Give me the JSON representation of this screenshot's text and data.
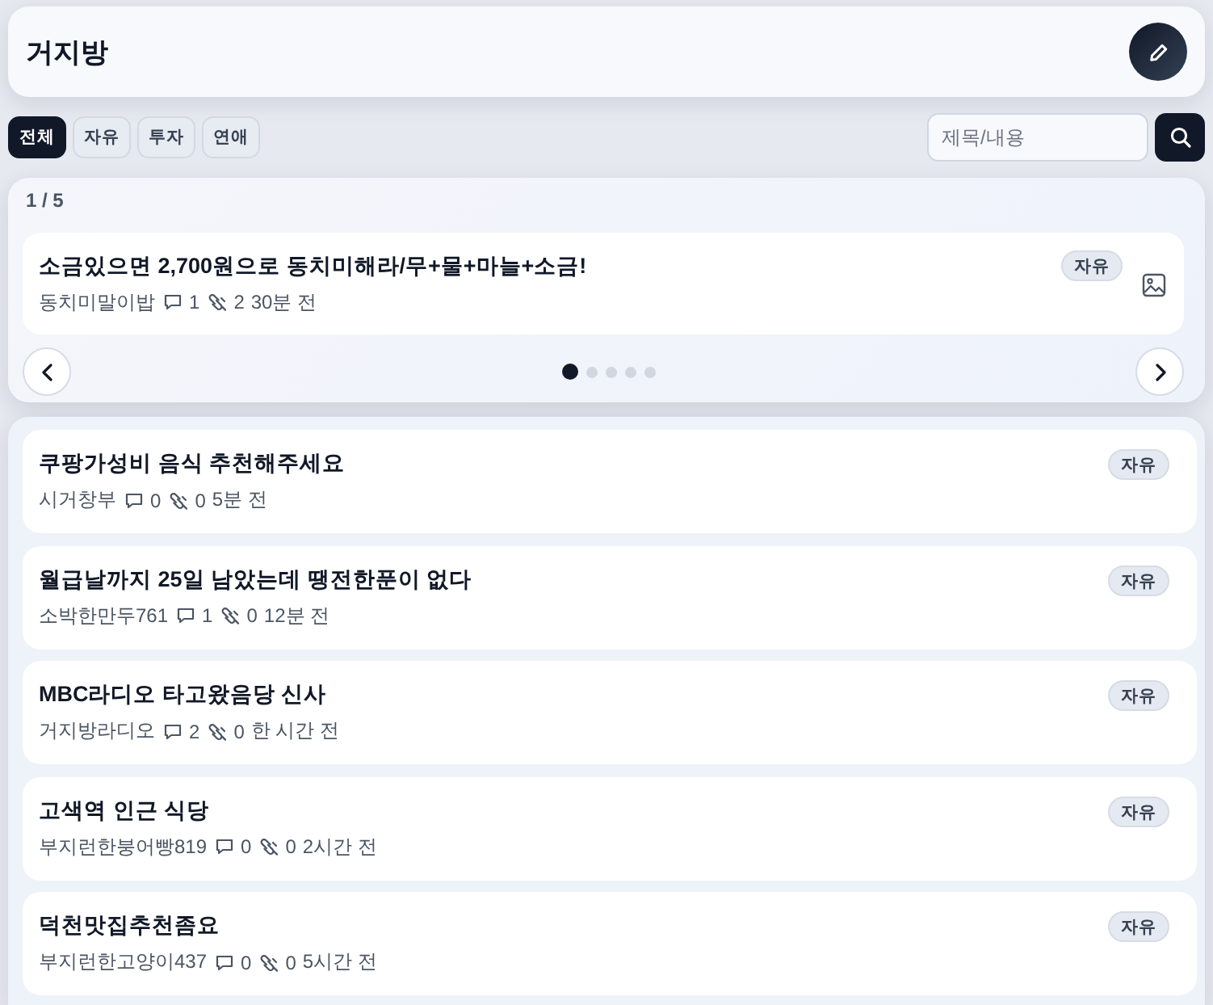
{
  "header": {
    "title": "거지방"
  },
  "categories": [
    {
      "label": "전체",
      "selected": true
    },
    {
      "label": "자유",
      "selected": false
    },
    {
      "label": "투자",
      "selected": false
    },
    {
      "label": "연애",
      "selected": false
    }
  ],
  "search": {
    "placeholder": "제목/내용"
  },
  "featured": {
    "counter": "1 / 5",
    "post": {
      "title": "소금있으면 2,700원으로 동치미해라/무+물+마늘+소금!",
      "author": "동치미말이밥",
      "comments": "1",
      "links": "2",
      "time": "30분 전",
      "tag": "자유",
      "has_image": true
    },
    "dots": [
      {
        "selected": true
      },
      {
        "selected": false
      },
      {
        "selected": false
      },
      {
        "selected": false
      },
      {
        "selected": false
      }
    ]
  },
  "posts": [
    {
      "title": "쿠팡가성비 음식 추천해주세요",
      "author": "시거창부",
      "comments": "0",
      "links": "0",
      "time": "5분 전",
      "tag": "자유"
    },
    {
      "title": "월급날까지 25일 남았는데 땡전한푼이 없다",
      "author": "소박한만두761",
      "comments": "1",
      "links": "0",
      "time": "12분 전",
      "tag": "자유"
    },
    {
      "title": "MBC라디오 타고왔음당 신사",
      "author": "거지방라디오",
      "comments": "2",
      "links": "0",
      "time": "한 시간 전",
      "tag": "자유"
    },
    {
      "title": "고색역 인근 식당",
      "author": "부지런한붕어빵819",
      "comments": "0",
      "links": "0",
      "time": "2시간 전",
      "tag": "자유"
    },
    {
      "title": "덕천맛집추천좀요",
      "author": "부지런한고양이437",
      "comments": "0",
      "links": "0",
      "time": "5시간 전",
      "tag": "자유"
    }
  ]
}
